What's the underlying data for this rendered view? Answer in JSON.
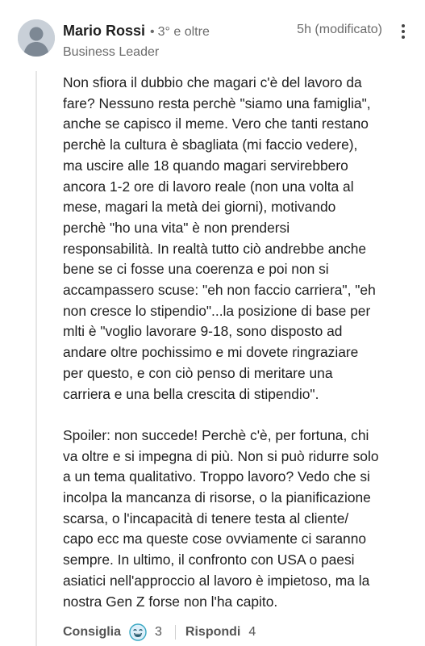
{
  "comment": {
    "author": {
      "name": "Mario Rossi",
      "separator": "•",
      "degree": "3° e oltre",
      "headline": "Business Leader"
    },
    "timestamp": "5h (modificato)",
    "paragraphs": [
      "Non sfiora il dubbio che magari c'è del lavoro da\nfare? Nessuno resta perchè \"siamo una famiglia\",\nanche se capisco il meme. Vero che tanti restano\nperchè la cultura è sbagliata (mi faccio vedere),\nma uscire alle 18 quando magari servirebbero\nancora 1-2 ore di lavoro reale (non una volta al\nmese, magari la metà dei giorni), motivando\nperchè \"ho una vita\" è non prendersi\nresponsabilità. In realtà tutto ciò andrebbe anche\nbene se ci fosse una coerenza e poi non si\naccampassero scuse: \"eh non faccio carriera\", \"eh\nnon cresce lo stipendio\"...la posizione di base per\nmlti è \"voglio lavorare 9-18, sono disposto ad\nandare oltre pochissimo e mi dovete ringraziare\nper questo, e con ciò penso di meritare una\ncarriera e una bella crescita di stipendio\".",
      "Spoiler: non succede! Perchè c'è, per fortuna, chi\nva oltre e si impegna di più. Non si può ridurre solo\na un tema qualitativo. Troppo lavoro? Vedo che si\nincolpa la mancanza di risorse, o la pianificazione\nscarsa, o l'incapacità di tenere testa al cliente/\ncapo ecc ma queste cose ovviamente ci saranno\nsempre. In ultimo, il confronto con USA o paesi\nasiatici nell'approccio al lavoro è impietoso, ma la\nnostra Gen Z forse non l'ha capito."
    ],
    "actions": {
      "like_label": "Consiglia",
      "reaction_icon": "funny-reaction-icon",
      "reaction_count": "3",
      "reply_label": "Rispondi",
      "reply_count": "4"
    }
  },
  "colors": {
    "text": "#1f1f1f",
    "muted": "#6b6b6b",
    "reaction_bg": "#dceffa",
    "reaction_stroke": "#37a7c2"
  }
}
